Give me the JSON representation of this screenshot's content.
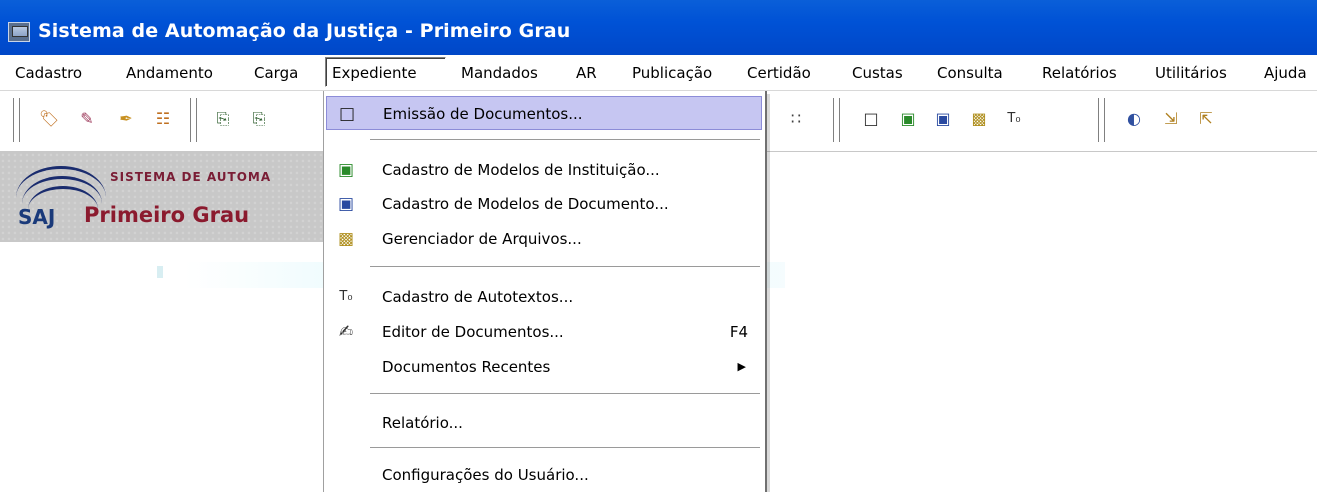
{
  "window": {
    "title": "Sistema de Automação da Justiça - Primeiro Grau",
    "app_icon": "saj-app-icon"
  },
  "menubar": {
    "items": [
      {
        "label": "Cadastro"
      },
      {
        "label": "Andamento"
      },
      {
        "label": "Carga"
      },
      {
        "label": "Expediente",
        "active": true
      },
      {
        "label": "Mandados"
      },
      {
        "label": "AR"
      },
      {
        "label": "Publicação"
      },
      {
        "label": "Certidão"
      },
      {
        "label": "Custas"
      },
      {
        "label": "Consulta"
      },
      {
        "label": "Relatórios"
      },
      {
        "label": "Utilitários"
      },
      {
        "label": "Ajuda"
      }
    ]
  },
  "logo": {
    "sistema": "SISTEMA DE AUTOMA",
    "saj": "SAJ",
    "grau": "Primeiro Grau"
  },
  "toolbar": {
    "icons": [
      "stamp-icon",
      "note-icon",
      "tag-icon",
      "tree-icon",
      "doc-copy-icon",
      "doc-search-icon",
      "hierarchy-icon",
      "doc-new-icon",
      "doc-green-icon",
      "doc-blue-icon",
      "doc-magnify-icon",
      "autotext-icon",
      "binoculars-icon",
      "move-down-icon",
      "move-up-icon"
    ]
  },
  "dropdown": {
    "items": [
      {
        "label": "Emissão de Documentos...",
        "icon": "document-emit-icon",
        "highlighted": true
      },
      {
        "label": "Cadastro de Modelos de Instituição...",
        "icon": "institution-model-icon"
      },
      {
        "label": "Cadastro de Modelos de Documento...",
        "icon": "document-model-icon"
      },
      {
        "label": "Gerenciador de Arquivos...",
        "icon": "file-manager-icon"
      },
      {
        "label": "Cadastro de Autotextos...",
        "icon": "autotext-icon"
      },
      {
        "label": "Editor de Documentos...",
        "icon": "document-editor-icon",
        "shortcut": "F4"
      },
      {
        "label": "Documentos Recentes",
        "submenu": true
      },
      {
        "label": "Relatório..."
      },
      {
        "label": "Configurações do Usuário..."
      }
    ]
  },
  "colors": {
    "titlebar": "#0052d6",
    "highlight": "#c6c6f2",
    "logo_red": "#8b1a2e",
    "logo_blue": "#1a2c6e"
  }
}
